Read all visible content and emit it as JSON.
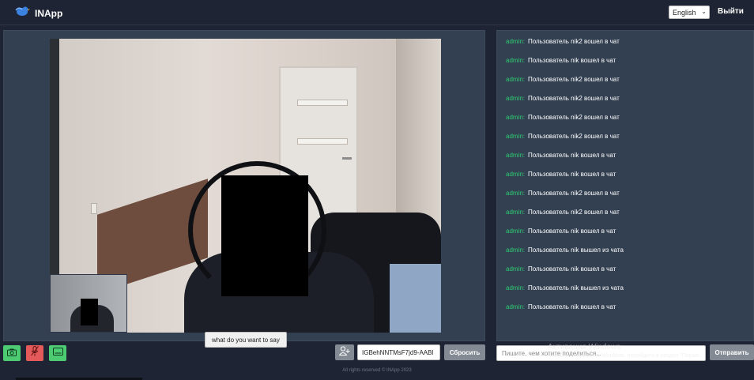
{
  "app": {
    "name": "INApp"
  },
  "header": {
    "language": "English",
    "logout_label": "Выйти"
  },
  "video": {
    "caption": "what do you want to say"
  },
  "chat": {
    "messages": [
      {
        "user": "admin:",
        "text": "Пользователь nik2 вошел в чат"
      },
      {
        "user": "admin:",
        "text": "Пользователь nik вошел в чат"
      },
      {
        "user": "admin:",
        "text": "Пользователь nik2 вошел в чат"
      },
      {
        "user": "admin:",
        "text": "Пользователь nik2 вошел в чат"
      },
      {
        "user": "admin:",
        "text": "Пользователь nik2 вошел в чат"
      },
      {
        "user": "admin:",
        "text": "Пользователь nik2 вошел в чат"
      },
      {
        "user": "admin:",
        "text": "Пользователь nik вошел в чат"
      },
      {
        "user": "admin:",
        "text": "Пользователь nik вошел в чат"
      },
      {
        "user": "admin:",
        "text": "Пользователь nik2 вошел в чат"
      },
      {
        "user": "admin:",
        "text": "Пользователь nik2 вошел в чат"
      },
      {
        "user": "admin:",
        "text": "Пользователь nik вошел в чат"
      },
      {
        "user": "admin:",
        "text": "Пользователь nik вышел из чата"
      },
      {
        "user": "admin:",
        "text": "Пользователь nik вошел в чат"
      },
      {
        "user": "admin:",
        "text": "Пользователь nik вышел из чата"
      },
      {
        "user": "admin:",
        "text": "Пользователь nik вошел в чат"
      }
    ],
    "input_placeholder": "Пишите, чем хотите поделиться...",
    "send_label": "Отправить"
  },
  "controls": {
    "room_id": "IGBehNNTMsF7jd9-AABl",
    "reset_label": "Сбросить"
  },
  "overlay": {
    "windows_title": "Активация Windows",
    "windows_subtitle": "Чтобы активировать Windows, перейдите в раздел \"Парам..."
  },
  "footer": {
    "text": "All rights reserved © INApp 2023"
  },
  "colors": {
    "background": "#1e2433",
    "panel": "#334051",
    "username": "#2ecc71",
    "button_green": "#4ccb73",
    "button_red": "#e45a5a",
    "button_gray": "#838a93"
  }
}
